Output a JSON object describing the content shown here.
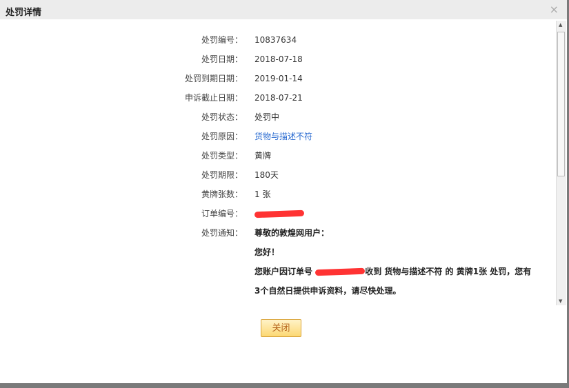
{
  "dialog": {
    "title": "处罚详情",
    "close_label": "×",
    "button_label": "关闭"
  },
  "fields": [
    {
      "label": "处罚编号：",
      "value": "10837634"
    },
    {
      "label": "处罚日期：",
      "value": "2018-07-18"
    },
    {
      "label": "处罚到期日期：",
      "value": "2019-01-14"
    },
    {
      "label": "申诉截止日期：",
      "value": "2018-07-21"
    },
    {
      "label": "处罚状态：",
      "value": "处罚中"
    },
    {
      "label": "处罚原因：",
      "value": "货物与描述不符"
    },
    {
      "label": "处罚类型：",
      "value": "黄牌"
    },
    {
      "label": "处罚期限：",
      "value": "180天"
    },
    {
      "label": "黄牌张数：",
      "value": "1 张"
    },
    {
      "label": "订单编号：",
      "value": ""
    }
  ],
  "notice": {
    "label": "处罚通知：",
    "greeting": "尊敬的敦煌网用户：",
    "hello": "您好！",
    "line1_pre": "您账户因订单号",
    "line1_post": "收到 货物与描述不符 的 黄牌1张 处罚，您有",
    "line2": "3个自然日提供申诉资料，请尽快处理。"
  }
}
